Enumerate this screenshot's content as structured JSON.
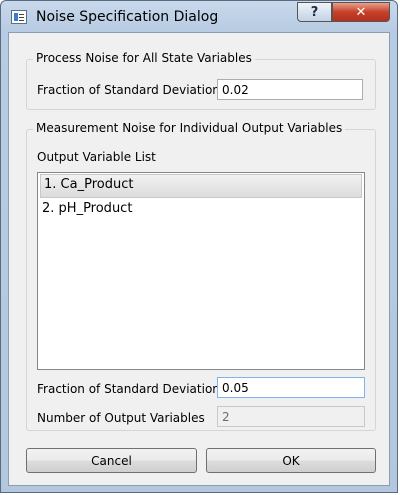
{
  "window": {
    "title": "Noise Specification Dialog",
    "help_label": "?",
    "close_label": "✕"
  },
  "process_group": {
    "title": "Process Noise for All State Variables",
    "fraction_label": "Fraction of Standard Deviation",
    "fraction_value": "0.02"
  },
  "measurement_group": {
    "title": "Measurement Noise for Individual Output Variables",
    "list_label": "Output Variable List",
    "items": [
      {
        "label": "1. Ca_Product",
        "selected": true
      },
      {
        "label": "2. pH_Product",
        "selected": false
      }
    ],
    "fraction_label": "Fraction of Standard Deviation",
    "fraction_value": "0.05",
    "count_label": "Number of Output Variables",
    "count_value": "2"
  },
  "buttons": {
    "cancel_label": "Cancel",
    "ok_label": "OK"
  }
}
